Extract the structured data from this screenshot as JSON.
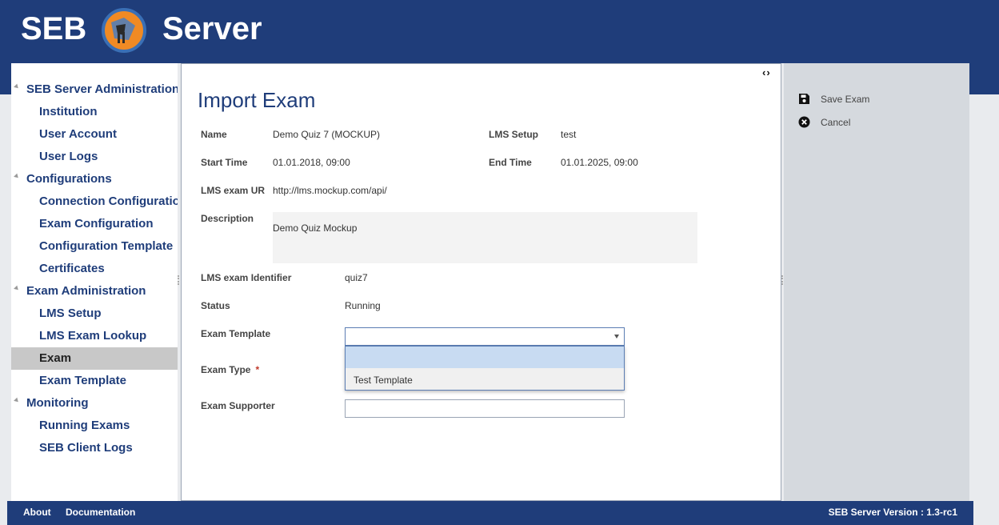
{
  "header": {
    "logo_left": "SEB",
    "logo_right": "Server"
  },
  "nav": {
    "categories": [
      {
        "label": "SEB Server Administration"
      },
      {
        "label": "Configurations"
      },
      {
        "label": "Exam Administration"
      },
      {
        "label": "Monitoring"
      }
    ],
    "items": [
      {
        "label": "Institution"
      },
      {
        "label": "User Account"
      },
      {
        "label": "User Logs"
      },
      {
        "label": "Connection Configuration"
      },
      {
        "label": "Exam Configuration"
      },
      {
        "label": "Configuration Template"
      },
      {
        "label": "Certificates"
      },
      {
        "label": "LMS Setup"
      },
      {
        "label": "LMS Exam Lookup"
      },
      {
        "label": "Exam"
      },
      {
        "label": "Exam Template"
      },
      {
        "label": "Running Exams"
      },
      {
        "label": "SEB Client Logs"
      }
    ],
    "selected": "Exam"
  },
  "content": {
    "toggle": "‹›",
    "title": "Import Exam",
    "fields": {
      "name_label": "Name",
      "name_value": "Demo Quiz 7 (MOCKUP)",
      "lms_setup_label": "LMS Setup",
      "lms_setup_value": "test",
      "start_label": "Start Time",
      "start_value": "01.01.2018, 09:00",
      "end_label": "End Time",
      "end_value": "01.01.2025, 09:00",
      "url_label": "LMS exam UR",
      "url_value": "http://lms.mockup.com/api/",
      "desc_label": "Description",
      "desc_value": "Demo Quiz Mockup",
      "identifier_label": "LMS exam Identifier",
      "identifier_value": "quiz7",
      "status_label": "Status",
      "status_value": "Running",
      "template_label": "Exam Template",
      "type_label": "Exam Type",
      "required_mark": "*",
      "supporter_label": "Exam Supporter"
    },
    "template_options": [
      "",
      "Test Template"
    ]
  },
  "actions": {
    "save_label": "Save Exam",
    "cancel_label": "Cancel"
  },
  "footer": {
    "about": "About",
    "documentation": "Documentation",
    "version": "SEB Server Version : 1.3-rc1"
  },
  "colors": {
    "brand": "#1f3d7a",
    "selected_nav": "#c8c8c8",
    "action_panel": "#d5d9de",
    "dropdown_highlight": "#c8dbf2"
  }
}
